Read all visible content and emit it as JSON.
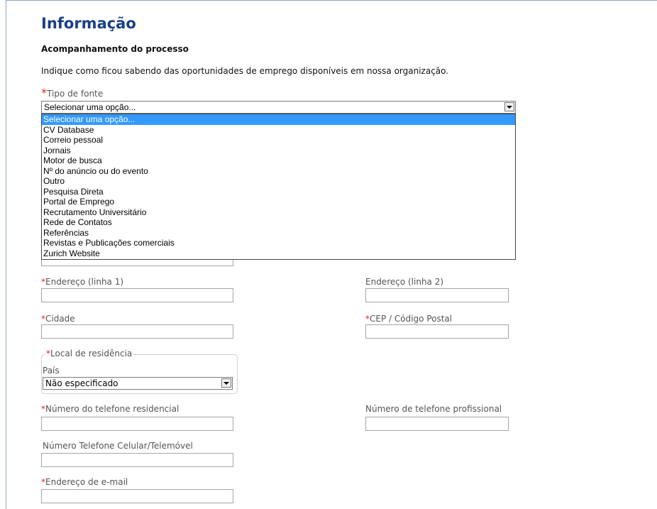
{
  "page": {
    "heading": "Informação",
    "subheading": "Acompanhamento do processo",
    "instructions": "Indique como ficou sabendo das oportunidades de emprego disponíveis em nossa organização."
  },
  "source_field": {
    "label": "Tipo de fonte",
    "selected": "Selecionar uma opção...",
    "options": [
      "Selecionar uma opção...",
      "CV Database",
      "Correio pessoal",
      "Jornais",
      "Motor de busca",
      "Nº do anúncio ou do evento",
      "Outro",
      "Pesquisa Direta",
      "Portal de Emprego",
      "Recrutamento Universitário",
      "Rede de Contatos",
      "Referências",
      "Revistas e Publicações comerciais",
      "Zurich Website"
    ]
  },
  "form": {
    "address1_label": "Endereço (linha 1)",
    "address2_label": "Endereço (linha 2)",
    "city_label": "Cidade",
    "postal_label": "CEP / Código Postal",
    "residence_legend": "Local de residência",
    "country_label": "País",
    "country_value": "Não especificado",
    "home_phone_label": "Número do telefone residencial",
    "work_phone_label": "Número de telefone profissional",
    "mobile_label": "Número Telefone Celular/Telemóvel",
    "email_label": "Endereço de e-mail",
    "required_mark": "*"
  },
  "colors": {
    "heading": "#1a3f88",
    "required": "#e3242b",
    "selection": "#3399ff",
    "frame": "#8fa6c3"
  }
}
